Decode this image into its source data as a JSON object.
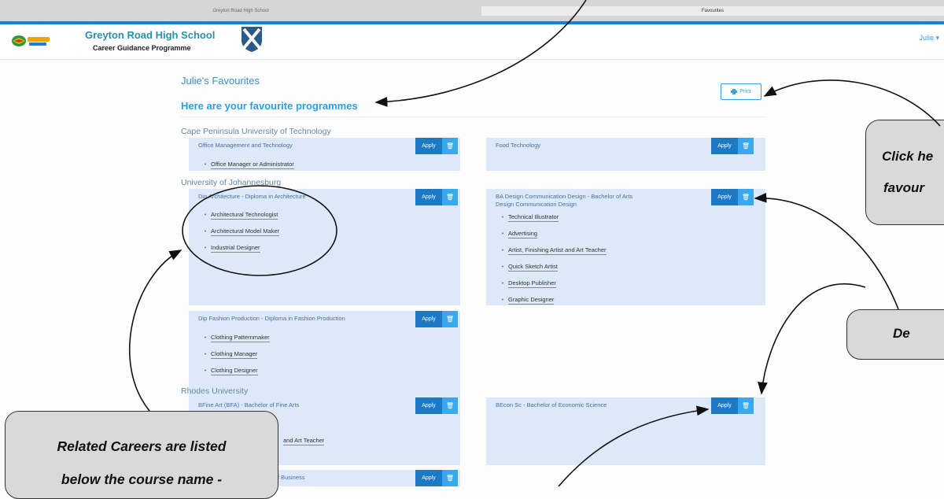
{
  "browser": {
    "tabs": [
      "Greyton Road High School",
      "Favourites"
    ]
  },
  "header": {
    "school": "Greyton Road High School",
    "programme": "Career Guidance Programme",
    "user_menu": "Julie ▾"
  },
  "page": {
    "title": "Julie's Favourites",
    "subtitle": "Here are your favourite programmes",
    "print_label": "Print"
  },
  "buttons": {
    "apply": "Apply",
    "delete_icon": "trash-icon"
  },
  "universities": [
    {
      "name": "Cape Peninsula University of Technology",
      "programmes": [
        {
          "name": "Office Management and Technology",
          "careers": [
            "Office Manager or Administrator"
          ]
        },
        {
          "name": "Food Technology",
          "careers": []
        }
      ]
    },
    {
      "name": "University of Johannesburg",
      "programmes": [
        {
          "name": "Dip Architecture - Diploma in Architecture",
          "careers": [
            "Architectural Technologist",
            "Architectural Model Maker",
            "Industrial Designer"
          ]
        },
        {
          "name": "BA Design Communication Design - Bachelor of Arts Design Communication Design",
          "careers": [
            "Technical Illustrator",
            "Advertising",
            "Artist, Finishing Artist and Art Teacher",
            "Quick Sketch Artist",
            "Desktop Publisher",
            "Graphic Designer"
          ]
        },
        {
          "name": "Dip Fashion Production - Diploma in Fashion Production",
          "careers": [
            "Clothing Patternmaker",
            "Clothing Manager",
            "Clothing Designer"
          ]
        }
      ]
    },
    {
      "name": "Rhodes University",
      "programmes": [
        {
          "name": "BFine Art (BFA) - Bachelor of Fine Arts",
          "careers": [
            "and Art Teacher"
          ]
        },
        {
          "name": "BEcon Sc - Bachelor of Economic Science",
          "careers": []
        },
        {
          "name": "or of Business",
          "careers": []
        }
      ]
    }
  ],
  "callouts": {
    "print": [
      "Click he",
      "favour"
    ],
    "delete": "De",
    "careers": [
      "Related Careers are listed",
      "below the course name -"
    ]
  }
}
